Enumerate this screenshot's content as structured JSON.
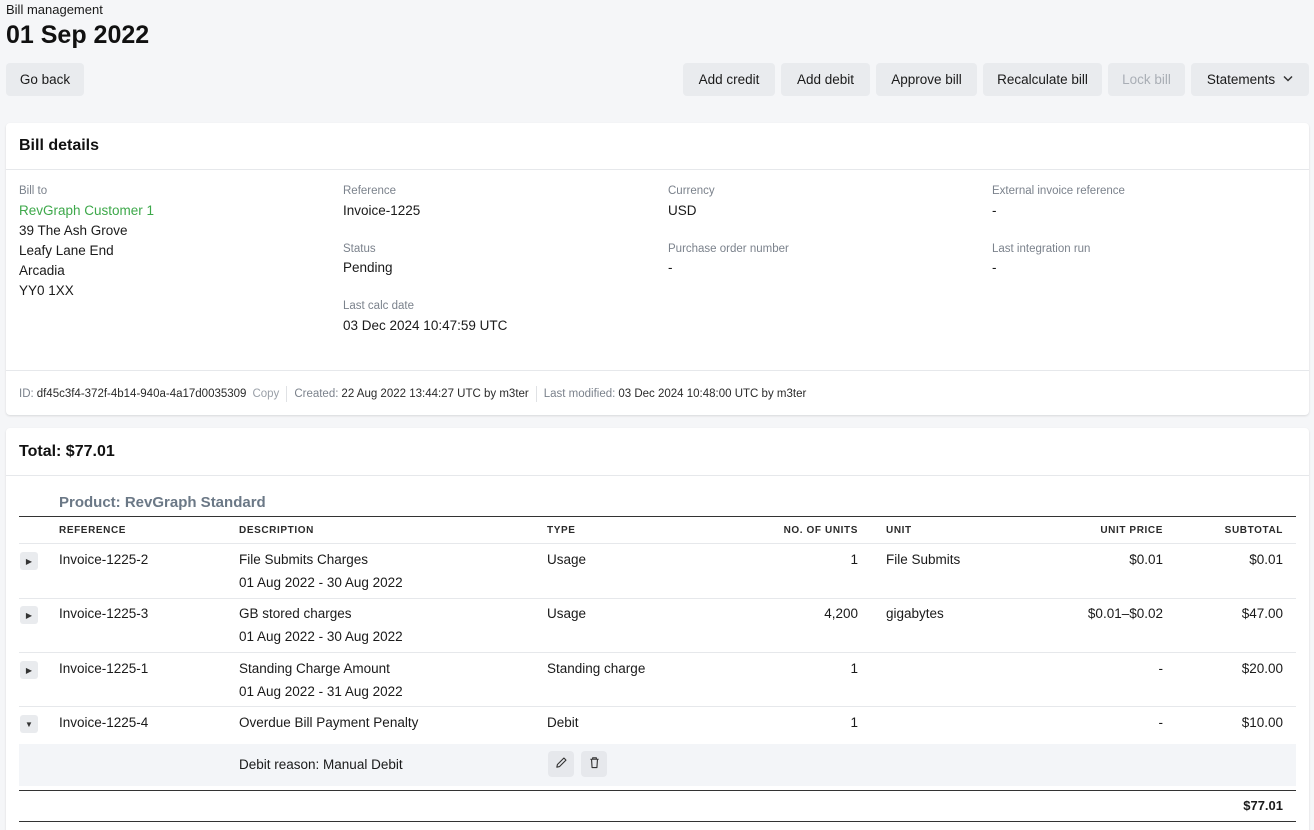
{
  "header": {
    "breadcrumb": "Bill management",
    "title": "01 Sep 2022"
  },
  "toolbar": {
    "go_back": "Go back",
    "add_credit": "Add credit",
    "add_debit": "Add debit",
    "approve_bill": "Approve bill",
    "recalculate_bill": "Recalculate bill",
    "lock_bill": "Lock bill",
    "statements": "Statements"
  },
  "bill_details": {
    "title": "Bill details",
    "bill_to_label": "Bill to",
    "customer_name": "RevGraph Customer 1",
    "address": [
      "39 The Ash Grove",
      "Leafy Lane End",
      "Arcadia",
      "YY0 1XX"
    ],
    "reference_label": "Reference",
    "reference": "Invoice-1225",
    "status_label": "Status",
    "status": "Pending",
    "last_calc_label": "Last calc date",
    "last_calc": "03 Dec 2024 10:47:59 UTC",
    "currency_label": "Currency",
    "currency": "USD",
    "po_label": "Purchase order number",
    "po": "-",
    "ext_ref_label": "External invoice reference",
    "ext_ref": "-",
    "last_integration_label": "Last integration run",
    "last_integration": "-",
    "meta": {
      "id_label": "ID:",
      "id": "df45c3f4-372f-4b14-940a-4a17d0035309",
      "copy": "Copy",
      "created_label": "Created:",
      "created": "22 Aug 2022 13:44:27 UTC by m3ter",
      "modified_label": "Last modified:",
      "modified": "03 Dec 2024 10:48:00 UTC by m3ter"
    }
  },
  "totals": {
    "title": "Total: $77.01",
    "product_title": "Product: RevGraph Standard",
    "columns": [
      "REFERENCE",
      "DESCRIPTION",
      "TYPE",
      "NO. OF UNITS",
      "UNIT",
      "UNIT PRICE",
      "SUBTOTAL"
    ],
    "rows": [
      {
        "reference": "Invoice-1225-2",
        "description": "File Submits Charges",
        "period": "01 Aug 2022 - 30 Aug 2022",
        "type": "Usage",
        "units": "1",
        "unit": "File Submits",
        "unit_price": "$0.01",
        "subtotal": "$0.01"
      },
      {
        "reference": "Invoice-1225-3",
        "description": "GB stored charges",
        "period": "01 Aug 2022 - 30 Aug 2022",
        "type": "Usage",
        "units": "4,200",
        "unit": "gigabytes",
        "unit_price": "$0.01–$0.02",
        "subtotal": "$47.00"
      },
      {
        "reference": "Invoice-1225-1",
        "description": "Standing Charge Amount",
        "period": "01 Aug 2022 - 31 Aug 2022",
        "type": "Standing charge",
        "units": "1",
        "unit": "",
        "unit_price": "-",
        "subtotal": "$20.00"
      },
      {
        "reference": "Invoice-1225-4",
        "description": "Overdue Bill Payment Penalty",
        "period": "",
        "type": "Debit",
        "units": "1",
        "unit": "",
        "unit_price": "-",
        "subtotal": "$10.00"
      }
    ],
    "debit_reason": "Debit reason: Manual Debit",
    "grand_total": "$77.01"
  },
  "icons": {
    "expand_collapsed": "caret-right-icon",
    "expand_open": "caret-down-icon",
    "edit": "pencil-icon",
    "delete": "trash-icon",
    "dropdown": "chevron-down-icon"
  },
  "colors": {
    "accent_green": "#3da84a",
    "button_bg": "#e9ebee",
    "page_bg": "#f5f6f8"
  }
}
